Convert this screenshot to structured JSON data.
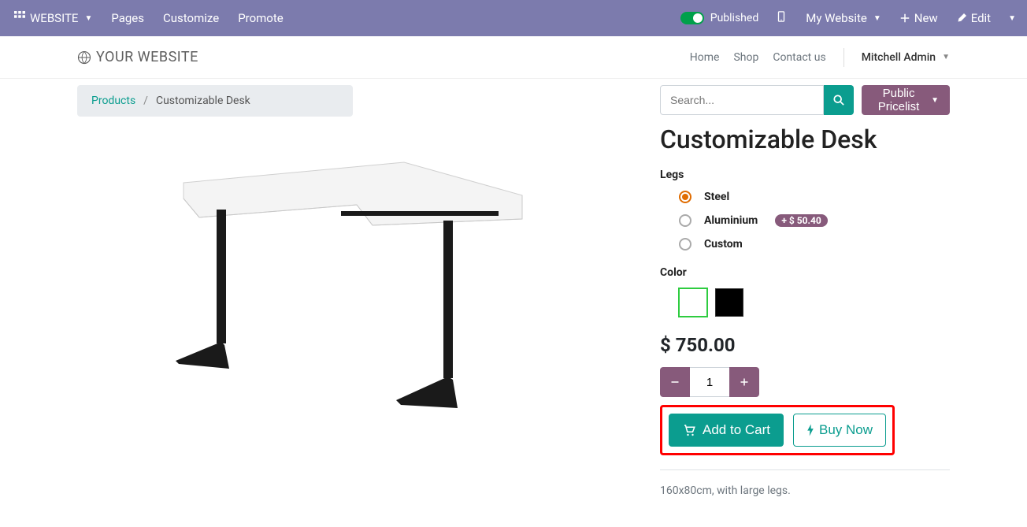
{
  "topbar": {
    "website_label": "WEBSITE",
    "pages": "Pages",
    "customize": "Customize",
    "promote": "Promote",
    "published": "Published",
    "my_website": "My Website",
    "new": "New",
    "edit": "Edit"
  },
  "site": {
    "logo_text": "YOUR WEBSITE",
    "nav": {
      "home": "Home",
      "shop": "Shop",
      "contact": "Contact us"
    },
    "user": "Mitchell Admin"
  },
  "breadcrumb": {
    "products": "Products",
    "sep": "/",
    "current": "Customizable Desk"
  },
  "search": {
    "placeholder": "Search..."
  },
  "pricelist": {
    "label": "Public Pricelist"
  },
  "product": {
    "title": "Customizable Desk",
    "legs_label": "Legs",
    "legs_options": [
      {
        "name": "Steel",
        "checked": true
      },
      {
        "name": "Aluminium",
        "checked": false,
        "surcharge": "+ $ 50.40"
      },
      {
        "name": "Custom",
        "checked": false
      }
    ],
    "color_label": "Color",
    "colors": [
      {
        "name": "white",
        "hex": "#ffffff",
        "selected": true
      },
      {
        "name": "black",
        "hex": "#000000",
        "selected": false
      }
    ],
    "price": "$ 750.00",
    "qty": "1",
    "add_to_cart": "Add to Cart",
    "buy_now": "Buy Now",
    "description": "160x80cm, with large legs."
  }
}
